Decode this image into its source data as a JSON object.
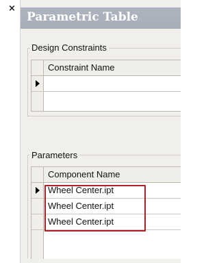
{
  "panel": {
    "close_glyph": "×",
    "title": "Parametric Table"
  },
  "design_constraints": {
    "group_label": "Design Constraints",
    "column_header": "Constraint Name",
    "rows": [
      {
        "value": ""
      }
    ]
  },
  "parameters": {
    "group_label": "Parameters",
    "column_header": "Component Name",
    "rows": [
      {
        "value": "Wheel Center.ipt"
      },
      {
        "value": "Wheel Center.ipt"
      },
      {
        "value": "Wheel Center.ipt"
      }
    ]
  },
  "colors": {
    "title_bar": "#aab1bc",
    "highlight_border": "#b11d24",
    "panel_bg": "#f0efec"
  }
}
